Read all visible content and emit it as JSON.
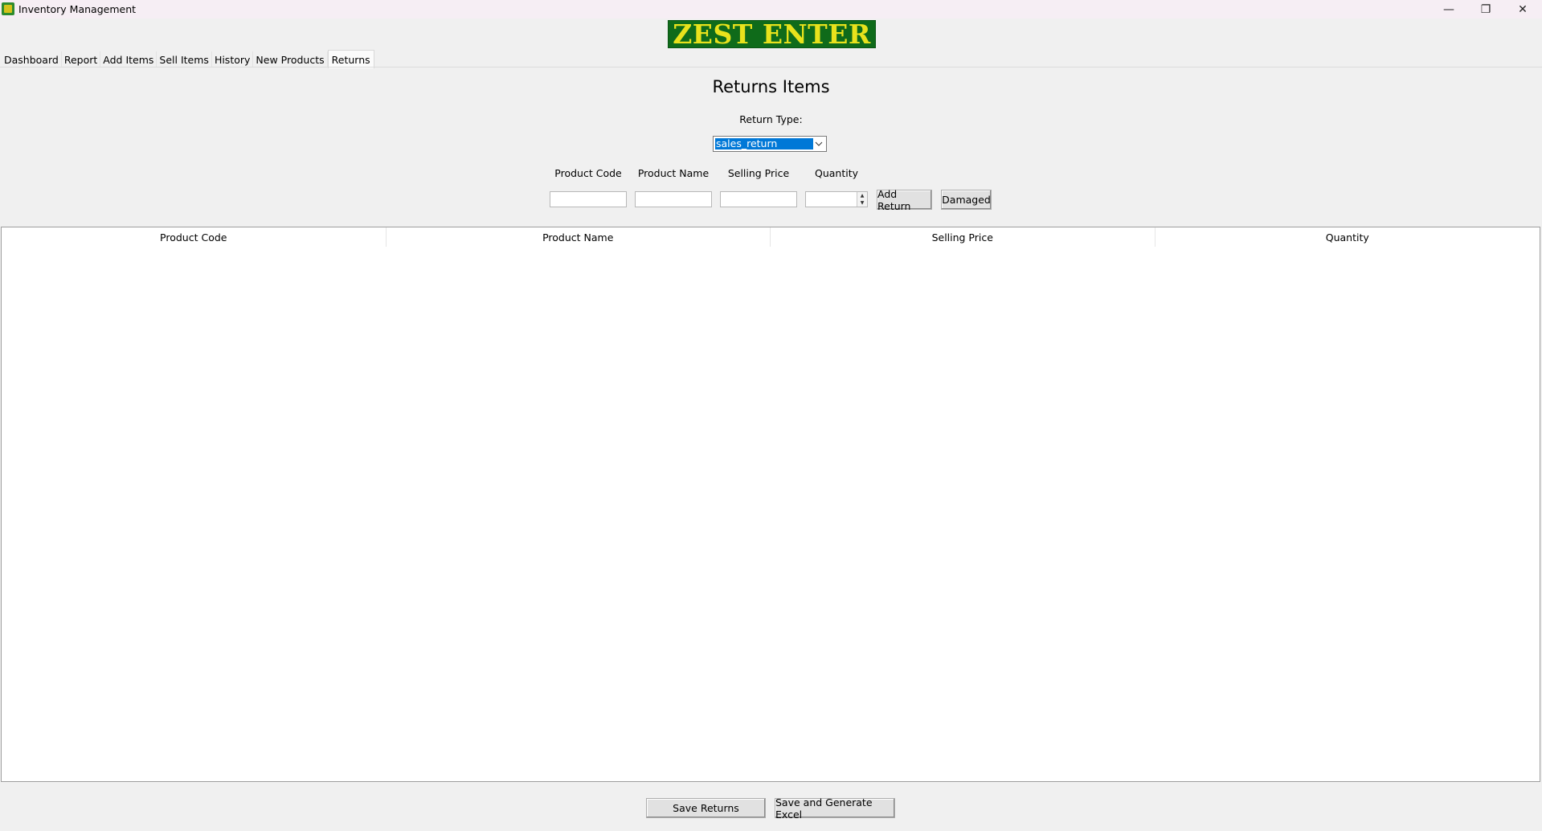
{
  "window": {
    "title": "Inventory Management",
    "controls": {
      "minimize": "—",
      "maximize": "❐",
      "close": "✕"
    }
  },
  "logo": {
    "text": "ZEST ENTER",
    "bg_color": "#0f6b1a",
    "text_color": "#e8e21c"
  },
  "tabs": [
    {
      "label": "Dashboard",
      "active": false
    },
    {
      "label": "Report",
      "active": false
    },
    {
      "label": "Add Items",
      "active": false
    },
    {
      "label": "Sell Items",
      "active": false
    },
    {
      "label": "History",
      "active": false
    },
    {
      "label": "New Products",
      "active": false
    },
    {
      "label": "Returns",
      "active": true
    }
  ],
  "returns": {
    "heading": "Returns Items",
    "return_type_label": "Return Type:",
    "return_type_value": "sales_return",
    "fields": {
      "product_code_label": "Product Code",
      "product_name_label": "Product Name",
      "selling_price_label": "Selling Price",
      "quantity_label": "Quantity",
      "product_code_value": "",
      "product_name_value": "",
      "selling_price_value": "",
      "quantity_value": ""
    },
    "add_return_label": "Add Return",
    "damaged_label": "Damaged",
    "table": {
      "columns": [
        "Product Code",
        "Product Name",
        "Selling Price",
        "Quantity"
      ],
      "rows": []
    },
    "save_returns_label": "Save Returns",
    "save_excel_label": "Save and Generate Excel"
  },
  "colors": {
    "selection": "#0078d7",
    "background": "#f0f0f0"
  }
}
